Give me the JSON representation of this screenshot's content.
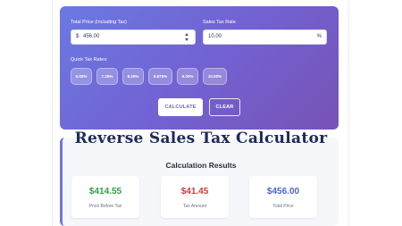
{
  "form": {
    "total_price_label": "Total Price (Including Tax)",
    "currency_symbol": "$",
    "total_price_value": "456.00",
    "tax_rate_label": "Sales Tax Rate",
    "tax_rate_value": "10.00",
    "percent_symbol": "%",
    "quick_rates_label": "Quick Tax Rates:",
    "quick_rates": [
      "6.00%",
      "7.25%",
      "8.25%",
      "8.875%",
      "9.00%",
      "10.00%"
    ],
    "calculate_label": "CALCULATE",
    "clear_label": "CLEAR"
  },
  "page_title": "Reverse Sales Tax Calculator",
  "results": {
    "heading": "Calculation Results",
    "cards": [
      {
        "amount": "$414.55",
        "caption": "Price Before Tax",
        "color": "#2e9e46"
      },
      {
        "amount": "$41.45",
        "caption": "Tax Amount",
        "color": "#d9363e"
      },
      {
        "amount": "$456.00",
        "caption": "Total Price",
        "color": "#4a67c9"
      }
    ]
  },
  "colors": {
    "gradient_start": "#6b79e2",
    "gradient_end": "#7753b6",
    "accent": "#6a67cc"
  }
}
